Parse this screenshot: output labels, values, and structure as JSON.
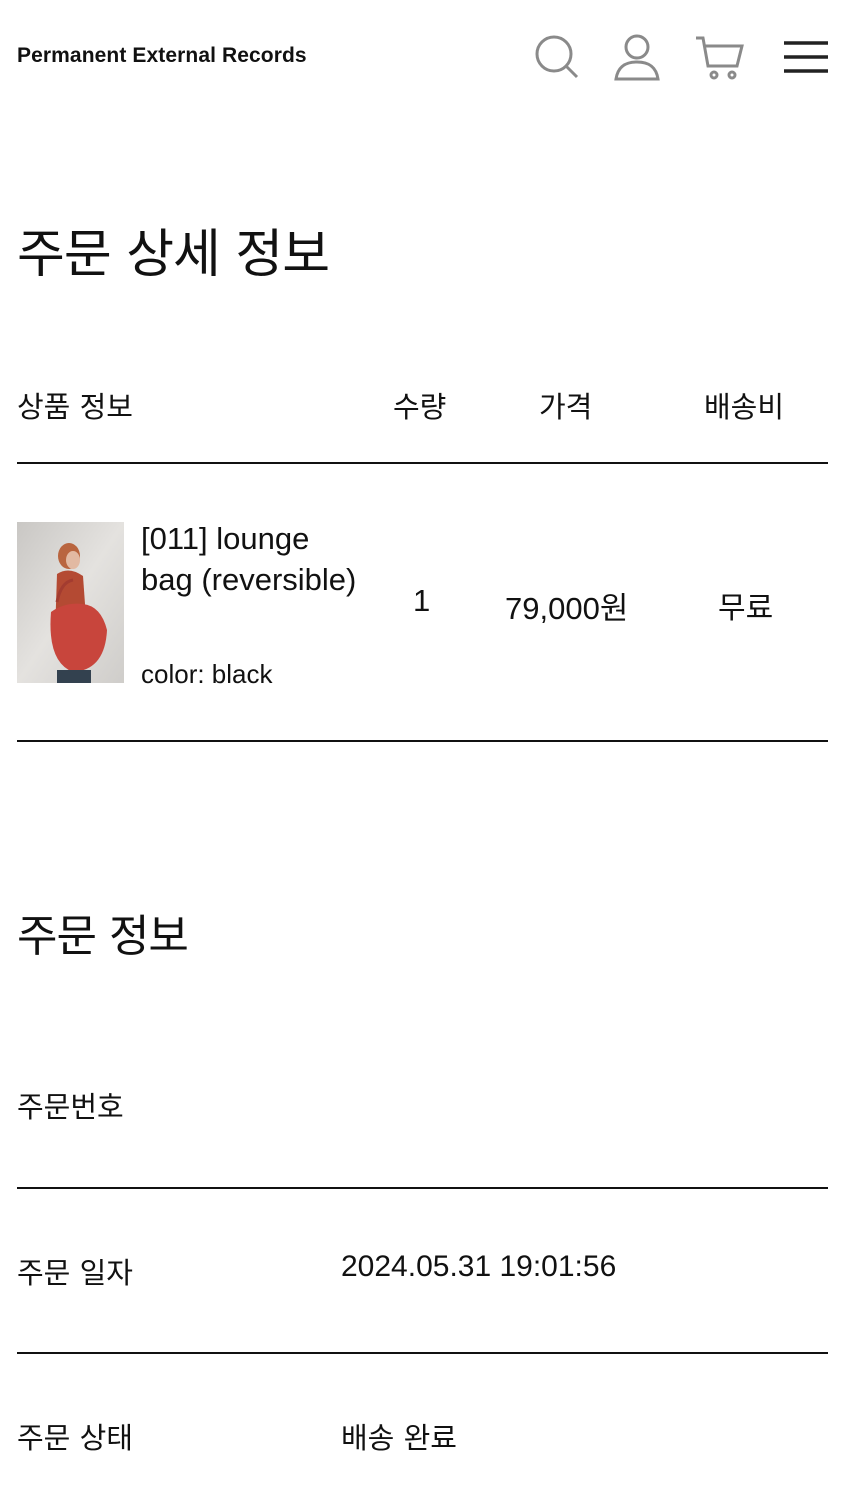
{
  "header": {
    "brand": "Permanent External Records",
    "icons": [
      "search-icon",
      "user-icon",
      "cart-icon",
      "menu-icon"
    ]
  },
  "page_title": "주문 상세 정보",
  "product_table": {
    "columns": {
      "product": "상품 정보",
      "quantity": "수량",
      "price": "가격",
      "shipping": "배송비"
    },
    "item": {
      "name": "[011] lounge bag (reversible)",
      "option": "color: black",
      "quantity": "1",
      "price": "79,000원",
      "shipping": "무료"
    }
  },
  "order_info": {
    "title": "주문 정보",
    "rows": [
      {
        "label": "주문번호",
        "value": ""
      },
      {
        "label": "주문 일자",
        "value": "2024.05.31 19:01:56"
      },
      {
        "label": "주문 상태",
        "value": "배송 완료"
      }
    ]
  }
}
